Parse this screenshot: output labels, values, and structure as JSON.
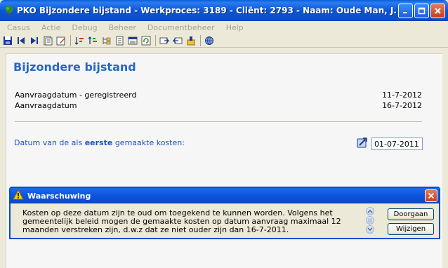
{
  "window": {
    "title": "PKO Bijzondere bijstand - Werkproces: 3189 - Cliënt: 2793 - Naam: Oude Man, J."
  },
  "menu": {
    "items": [
      "Casus",
      "Actie",
      "Debug",
      "Beheer",
      "Documentbeheer",
      "Help"
    ]
  },
  "toolbar": {
    "icons": [
      "save-icon",
      "first-record-icon",
      "last-record-icon",
      "notes-icon",
      "edit-icon",
      "sort-icon",
      "sort-desc-icon",
      "tree-icon",
      "document-icon",
      "list-icon",
      "refresh-icon",
      "send-icon",
      "receive-icon",
      "history-icon",
      "network-icon"
    ]
  },
  "page": {
    "title": "Bijzondere bijstand",
    "rows": [
      {
        "label": "Aanvraagdatum - geregistreerd",
        "value": "11-7-2012"
      },
      {
        "label": "Aanvraagdatum",
        "value": "16-7-2012"
      }
    ],
    "datum": {
      "label_before": "Datum van de als ",
      "label_bold": "eerste",
      "label_after": " gemaakte kosten:",
      "value": "01-07-2011"
    }
  },
  "warning": {
    "title": "Waarschuwing",
    "lines": [
      "Kosten op deze datum zijn te oud om toegekend te kunnen worden. Volgens het",
      "gemeentelijk beleid mogen de gemaakte kosten op datum aanvraag maximaal 12",
      "maanden verstreken zijn, d.w.z dat ze niet ouder zijn dan 16-7-2011."
    ],
    "btn_continue": "Doorgaan",
    "btn_change": "Wijzigen"
  },
  "colors": {
    "accent": "#2867c7",
    "titlebar": "#0a4ec8",
    "window_bg": "#ece9d8"
  }
}
